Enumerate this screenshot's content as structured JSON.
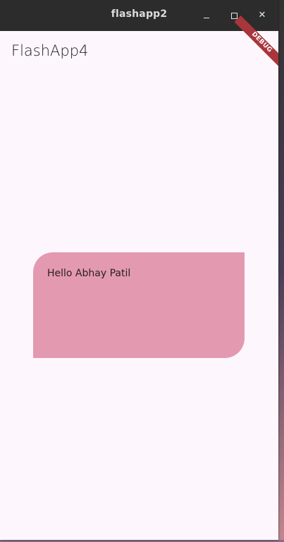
{
  "window": {
    "title": "flashapp2",
    "controls": {
      "minimize_icon": "minimize-icon",
      "maximize_icon": "maximize-icon",
      "close_icon": "close-icon",
      "close_glyph": "✕"
    }
  },
  "app": {
    "title": "FlashApp4",
    "debug_banner": "DEBUG",
    "card_text": "Hello Abhay Patil"
  },
  "colors": {
    "titlebar": "#2c2c2c",
    "background": "#fdf7fd",
    "card": "#e39ab0",
    "debug_banner": "#a8363a"
  }
}
